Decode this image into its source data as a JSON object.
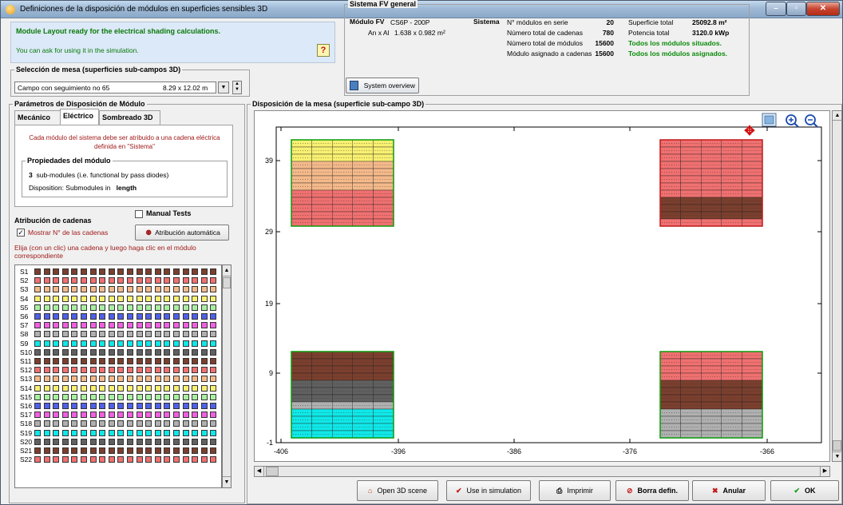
{
  "window": {
    "title": "Definiciones de la disposición de módulos en superficies sensibles 3D"
  },
  "status": {
    "line1": "Module Layout ready for the electrical shading calculations.",
    "line2": "You can ask for using it in the simulation.",
    "help": "?"
  },
  "mesa": {
    "legend": "Selección de mesa  (superficies sub-campos 3D)",
    "selected": "Campo con seguimiento no 65",
    "size": "8.29 x 12.02 m"
  },
  "params": {
    "legend": "Parámetros de Disposición de Módulo",
    "tabs": [
      "Mecánico",
      "Eléctrico",
      "Sombreado 3D"
    ],
    "info": "Cada módulo del sistema debe ser atribuido a una cadena eléctrica definida en \"Sistema\"",
    "props_legend": "Propiedades del módulo",
    "submodules_count": "3",
    "submodules_text": "sub-modules (i.e. functional by pass diodes)",
    "disposition_label": "Disposition:  Submodules in",
    "disposition_value": "length"
  },
  "atribucion": {
    "title": "Atribución de cadenas",
    "manual_tests": "Manual Tests",
    "show_numbers": "Mostrar N° de las cadenas",
    "auto_button": "Atribución automática",
    "instruction": "Elija (con un clic) una cadena y luego haga clic en el módulo correspondiente"
  },
  "strings": [
    {
      "label": "S1",
      "color": "#7b3f2e"
    },
    {
      "label": "S2",
      "color": "#f07070"
    },
    {
      "label": "S3",
      "color": "#f4b98a"
    },
    {
      "label": "S4",
      "color": "#f8f070"
    },
    {
      "label": "S5",
      "color": "#a8f0a0"
    },
    {
      "label": "S6",
      "color": "#5060e8"
    },
    {
      "label": "S7",
      "color": "#f060e0"
    },
    {
      "label": "S8",
      "color": "#b0b0b0"
    },
    {
      "label": "S9",
      "color": "#10e8e8"
    },
    {
      "label": "S10",
      "color": "#606060"
    },
    {
      "label": "S11",
      "color": "#7b3f2e"
    },
    {
      "label": "S12",
      "color": "#f07070"
    },
    {
      "label": "S13",
      "color": "#f4b98a"
    },
    {
      "label": "S14",
      "color": "#f8f070"
    },
    {
      "label": "S15",
      "color": "#a8f0a0"
    },
    {
      "label": "S16",
      "color": "#5060e8"
    },
    {
      "label": "S17",
      "color": "#f060e0"
    },
    {
      "label": "S18",
      "color": "#b0b0b0"
    },
    {
      "label": "S19",
      "color": "#10e8e8"
    },
    {
      "label": "S20",
      "color": "#606060"
    },
    {
      "label": "S21",
      "color": "#7b3f2e"
    },
    {
      "label": "S22",
      "color": "#f07070"
    }
  ],
  "system": {
    "legend": "Sistema FV general",
    "module_label": "Módulo FV",
    "module_value": "CS6P - 200P",
    "dims_label": "An x Al",
    "dims_value": "1.638 x 0.982 m²",
    "sistema_label": "Sistema",
    "series_label": "N° módulos en serie",
    "series_value": "20",
    "strings_label": "Número total de cadenas",
    "strings_value": "780",
    "modules_label": "Número total de módulos",
    "modules_value": "15600",
    "assigned_label": "Módulo asignado a cadenas",
    "assigned_value": "15600",
    "surface_label": "Superficie total",
    "surface_value": "25092.8 m²",
    "power_label": "Potencia total",
    "power_value": "3120.0 kWp",
    "placed_msg": "Todos los módulos situados.",
    "assigned_msg": "Todos los módulos asignados.",
    "overview_button": "System overview"
  },
  "layout": {
    "legend": "Disposición de la mesa (superficie sub-campo 3D)",
    "x_ticks": [
      "-406",
      "-396",
      "-386",
      "-376",
      "-366"
    ],
    "y_ticks": [
      "-1",
      "9",
      "19",
      "29",
      "39"
    ]
  },
  "buttons": {
    "open3d": "Open 3D scene",
    "use": "Use in simulation",
    "print": "Imprimir",
    "borra": "Borra defin.",
    "anular": "Anular",
    "ok": "OK"
  }
}
